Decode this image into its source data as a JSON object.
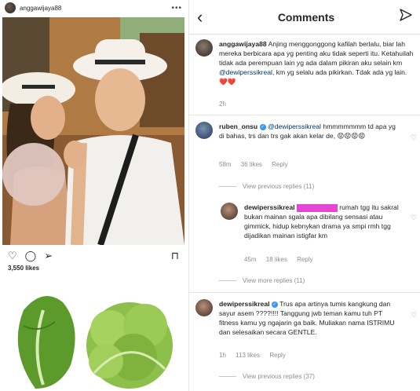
{
  "post": {
    "username": "anggawijaya88",
    "likes": "3,550 likes"
  },
  "comments_screen": {
    "title": "Comments",
    "caption": {
      "username": "anggawijaya88",
      "text_before": "Anjing menggonggong kafilah berlalu, biar lah mereka berbicara apa yg penting aku tidak seperti itu. Ketahuilah tidak ada perempuan lain yg ada dalam pikiran aku selain km ",
      "mention": "@dewiperssikreal",
      "text_after": ", km yg selalu ada pikirkan. Tdak ada yg lain. ❤️❤️",
      "time": "2h"
    },
    "comments": [
      {
        "username": "ruben_onsu",
        "mention": "@dewiperssikreal",
        "text": "hmmmmmmm td apa yg di bahas, trs dan trs gak akan kelar de, 😡😡😡😡",
        "time": "58m",
        "likes": "36 likes",
        "reply": "Reply",
        "view_replies": "View previous replies (11)"
      },
      {
        "username": "dewiperssikreal",
        "text_after_redact": " rumah tgg itu sakral bukan mainan sgala apa dibilang sensasi atau gimmick, hidup kebnykan drama ya smpi rmh tgg dijadikan mainan istigfar km",
        "time": "45m",
        "likes": "18 likes",
        "reply": "Reply",
        "view_more": "View more replies (11)"
      },
      {
        "username": "dewiperssikreal",
        "text": "Trus apa artinya tumis kangkung dan sayur asem ????!!!! Tanggung jwb teman kamu tuh PT fitness kamu yg ngajarin ga baik. Muliakan nama ISTRIMU dan selesaikan secara GENTLE.",
        "time": "1h",
        "likes": "113 likes",
        "reply": "Reply",
        "view_replies": "View previous replies (37)"
      }
    ]
  }
}
